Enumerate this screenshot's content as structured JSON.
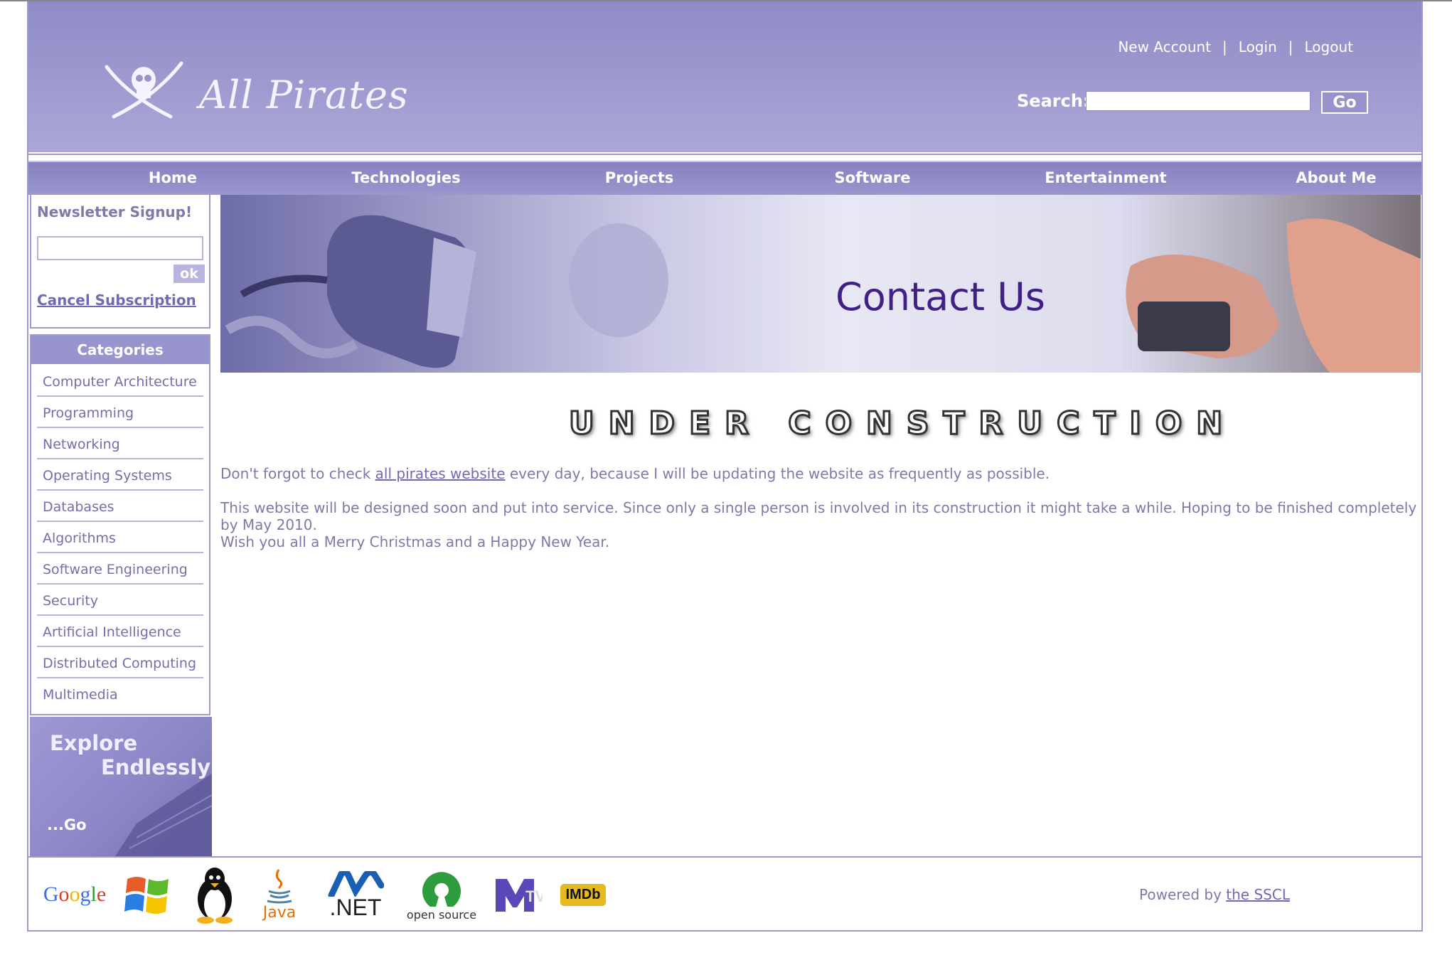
{
  "header": {
    "logo_text": "All Pirates",
    "links": [
      "New Account",
      "Login",
      "Logout"
    ],
    "search_label": "Search:",
    "search_button": "Go"
  },
  "nav": [
    "Home",
    "Technologies",
    "Projects",
    "Software",
    "Entertainment",
    "About Me"
  ],
  "newsletter": {
    "title": "Newsletter Signup!",
    "ok_button": "ok",
    "cancel_link": "Cancel Subscription"
  },
  "categories": {
    "title": "Categories",
    "items": [
      "Computer Architecture",
      "Programming",
      "Networking",
      "Operating Systems",
      "Databases",
      "Algorithms",
      "Software Engineering",
      "Security",
      "Artificial Intelligence",
      "Distributed Computing",
      "Multimedia"
    ]
  },
  "explore": {
    "line1": "Explore",
    "line2": "Endlessly",
    "go": "...Go"
  },
  "banner": {
    "title": "Contact Us"
  },
  "content": {
    "heading": "UNDER CONSTRUCTION",
    "p1_before": "Don't forgot to check ",
    "p1_link": "all pirates website",
    "p1_after": " every day, because I will be updating the website as frequently as possible.",
    "p2": "This website will be designed soon and put into service. Since only a single person is involved in its construction it might take a while. Hoping to be finished completely by May 2010.",
    "p3": "Wish you all a Merry Christmas and a Happy New Year."
  },
  "footer": {
    "logos": [
      "Google",
      "Windows",
      "Linux",
      "Java",
      "Microsoft .NET",
      "open source",
      "MTV",
      "IMDb"
    ],
    "powered_prefix": "Powered by ",
    "powered_link": "the SSCL"
  },
  "colors": {
    "header_top": "#8f8bc6",
    "header_bottom": "#aaa7d8",
    "accent": "#9e9bcc",
    "text": "#7e7aa8",
    "banner_title": "#421f86"
  }
}
